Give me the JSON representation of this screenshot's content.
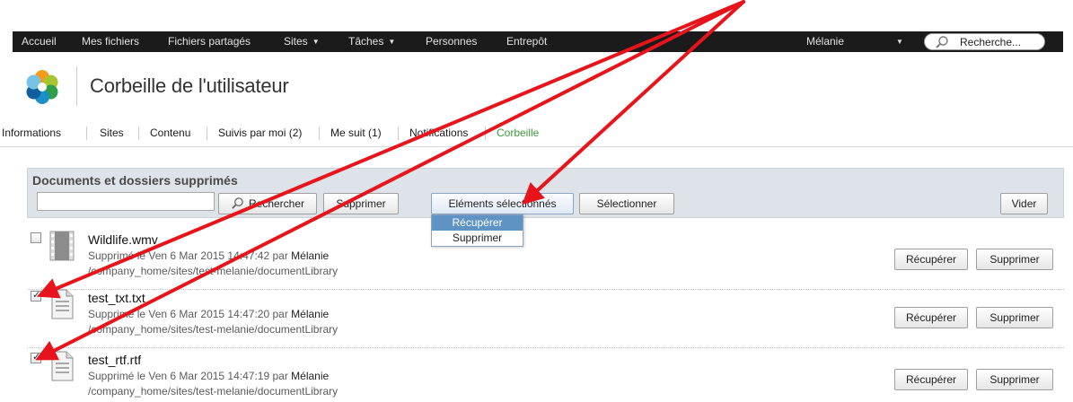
{
  "nav": {
    "items": [
      {
        "label": "Accueil"
      },
      {
        "label": "Mes fichiers"
      },
      {
        "label": "Fichiers partagés"
      },
      {
        "label": "Sites",
        "caret": "▼"
      },
      {
        "label": "Tâches",
        "caret": "▼"
      },
      {
        "label": "Personnes"
      },
      {
        "label": "Entrepôt"
      }
    ],
    "user": "Mélanie",
    "user_caret": "▼",
    "search_placeholder": "Recherche..."
  },
  "header": {
    "title": "Corbeille de l'utilisateur"
  },
  "tabs": [
    {
      "label": "Informations"
    },
    {
      "label": "Sites"
    },
    {
      "label": "Contenu"
    },
    {
      "label": "Suivis par moi (2)"
    },
    {
      "label": "Me suit (1)"
    },
    {
      "label": "Notifications"
    },
    {
      "label": "Corbeille",
      "active": true
    }
  ],
  "panel": {
    "title": "Documents et dossiers supprimés",
    "filter_value": "",
    "search_button": "Rechercher",
    "delete_button": "Supprimer",
    "selected_items_button": "Eléments sélectionnés",
    "select_button": "Sélectionner",
    "empty_button": "Vider",
    "dropdown": [
      {
        "label": "Récupérer",
        "highlighted": true
      },
      {
        "label": "Supprimer"
      }
    ]
  },
  "rows": [
    {
      "name": "Wildlife.wmv",
      "icon": "video-file-icon",
      "checked": false,
      "deleted_prefix": "Supprimé le Ven 6 Mar 2015 14:47:42 par",
      "user": "Mélanie",
      "path": "/company_home/sites/test-melanie/documentLibrary",
      "recover_label": "Récupérer",
      "delete_label": "Supprimer"
    },
    {
      "name": "test_txt.txt",
      "icon": "text-file-icon",
      "checked": true,
      "deleted_prefix": "Supprimé le Ven 6 Mar 2015 14:47:20 par",
      "user": "Mélanie",
      "path": "/company_home/sites/test-melanie/documentLibrary",
      "recover_label": "Récupérer",
      "delete_label": "Supprimer"
    },
    {
      "name": "test_rtf.rtf",
      "icon": "text-file-icon",
      "checked": true,
      "deleted_prefix": "Supprimé le Ven 6 Mar 2015 14:47:19 par",
      "user": "Mélanie",
      "path": "/company_home/sites/test-melanie/documentLibrary",
      "recover_label": "Récupérer",
      "delete_label": "Supprimer"
    }
  ],
  "colors": {
    "topbar": "#1b1b1b",
    "active_tab": "#3d9b3d",
    "panel_header": "#dde3e8",
    "annotation_arrow": "#e8141c",
    "dropdown_highlight": "#5f93c4"
  }
}
